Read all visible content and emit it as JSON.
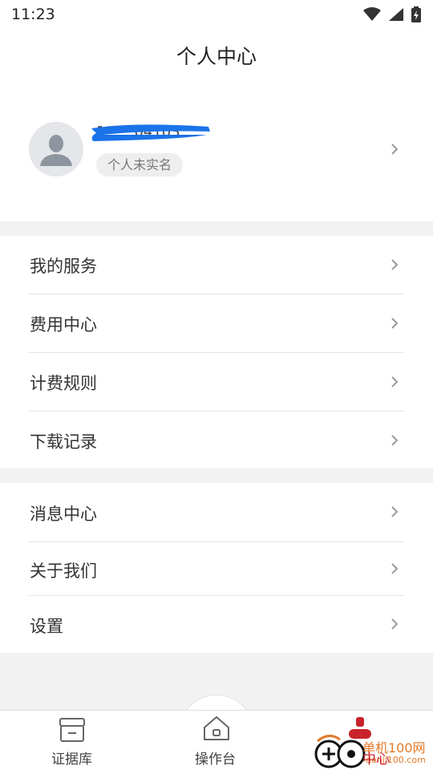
{
  "status_bar": {
    "time": "11:23",
    "icons": [
      "wifi-icon",
      "signal-icon",
      "battery-charging-icon"
    ]
  },
  "header": {
    "title": "个人中心"
  },
  "profile": {
    "username": "1****04103",
    "verification_status": "个人未实名",
    "redaction_color": "#1a73e8"
  },
  "menu_groups": [
    {
      "items": [
        {
          "label": "我的服务"
        },
        {
          "label": "费用中心"
        },
        {
          "label": "计费规则"
        },
        {
          "label": "下载记录"
        }
      ]
    },
    {
      "items": [
        {
          "label": "消息中心"
        },
        {
          "label": "关于我们"
        },
        {
          "label": "设置"
        }
      ]
    }
  ],
  "bottom_nav": {
    "items": [
      {
        "label": "证据库",
        "icon": "archive-box-icon"
      },
      {
        "label": "操作台",
        "icon": "home-icon"
      },
      {
        "label": "中心",
        "icon": "person-icon",
        "active": true
      }
    ]
  },
  "watermark": {
    "text": "单机100网",
    "url": "danji100.com"
  },
  "colors": {
    "accent": "#c8232c",
    "background": "#f2f2f2",
    "surface": "#ffffff"
  }
}
